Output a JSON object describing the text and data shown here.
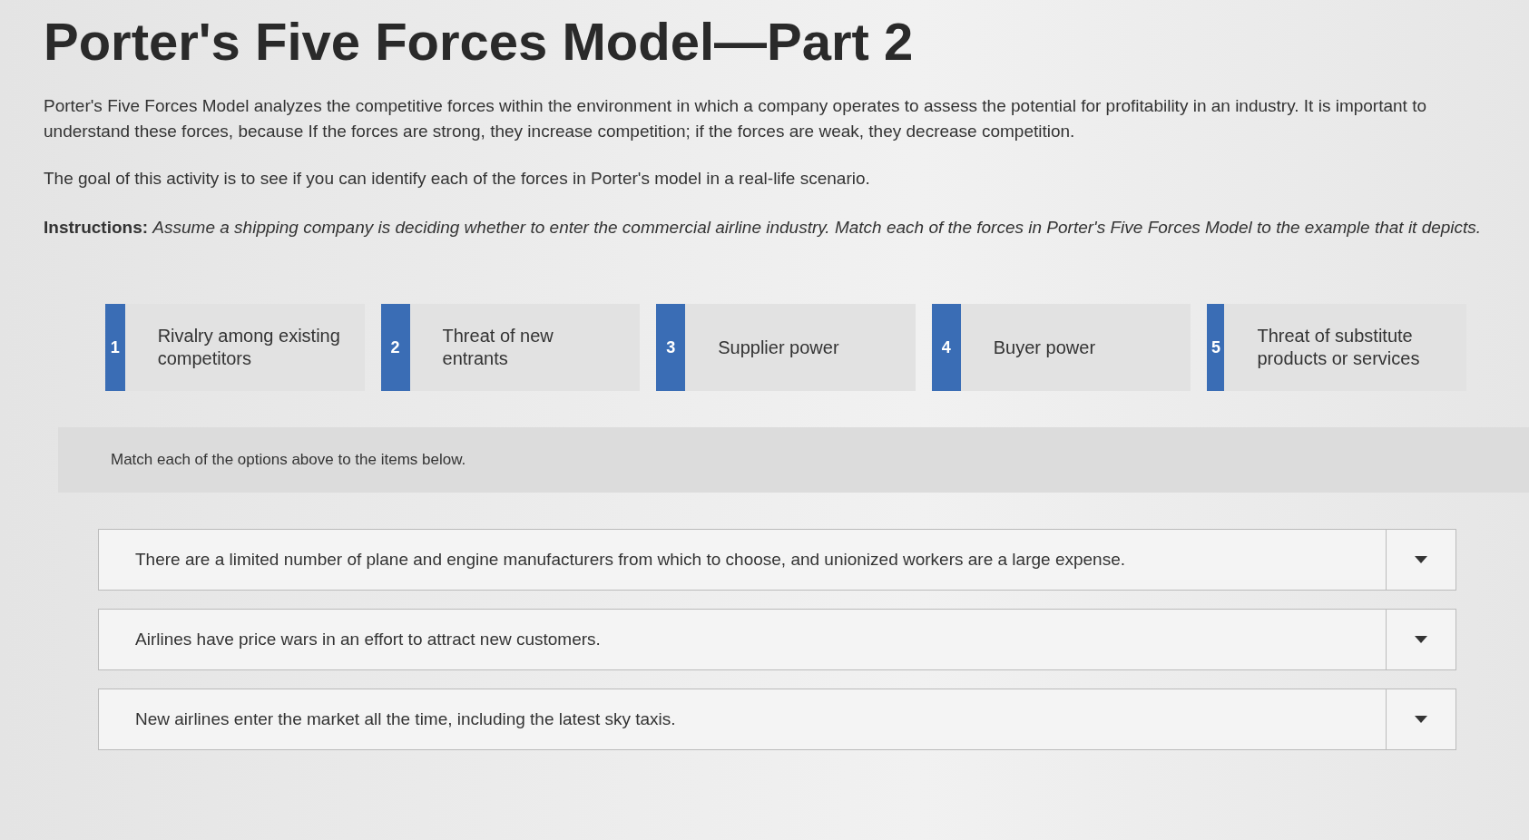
{
  "title": "Porter's Five Forces Model—Part 2",
  "paragraphs": [
    "Porter's Five Forces Model analyzes the competitive forces within the environment in which a company operates to assess the potential for profitability in an industry. It is important to understand these forces, because If the forces are strong, they increase competition; if the forces are weak, they decrease competition.",
    "The goal of this activity is to see if you can identify each of the forces in Porter's model in a real-life scenario."
  ],
  "instructions": "**Instructions:** *Assume a shipping company is deciding whether to enter the commercial airline industry. Match each of the forces in Porter's Five Forces Model to the example that it depicts.*",
  "options": [
    {
      "number": "1",
      "label": "Rivalry among existing competitors"
    },
    {
      "number": "2",
      "label": "Threat of new entrants"
    },
    {
      "number": "3",
      "label": "Supplier power"
    },
    {
      "number": "4",
      "label": "Buyer power"
    },
    {
      "number": "5",
      "label": "Threat of substitute products or services"
    }
  ],
  "match_prompt": "Match each of the options above to the items below.",
  "items": [
    {
      "text": "There are a limited number of plane and engine manufacturers from which to choose, and unionized workers are a large expense."
    },
    {
      "text": "Airlines have price wars in an effort to attract new customers."
    },
    {
      "text": "New airlines enter the market all the time, including the latest sky taxis."
    }
  ]
}
